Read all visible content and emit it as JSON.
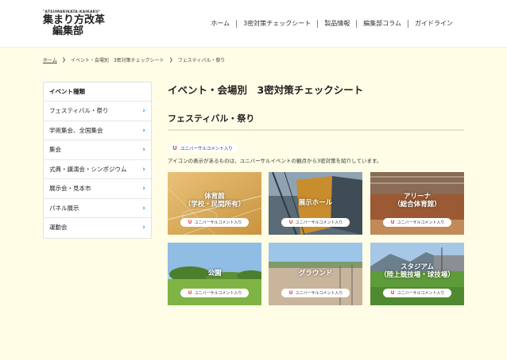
{
  "header": {
    "logo_sub": "\"ATSUMARIKATA-KAIKAKU\"",
    "logo_line1": "集まり方改革",
    "logo_line2": "編集部",
    "nav": [
      "ホーム",
      "3密対策チェックシート",
      "製品情報",
      "編集部コラム",
      "ガイドライン"
    ]
  },
  "breadcrumb": [
    "ホーム",
    "イベント・会場別　3密対策チェックシート",
    "フェスティバル・祭り"
  ],
  "sidebar": {
    "title": "イベント種類",
    "items": [
      {
        "label": "フェスティバル・祭り"
      },
      {
        "label": "学術集会、全国集会"
      },
      {
        "label": "集会"
      },
      {
        "label": "式典・講演会・シンポジウム"
      },
      {
        "label": "展示会・見本市"
      },
      {
        "label": "パネル展示"
      },
      {
        "label": "運動会"
      }
    ]
  },
  "main": {
    "title": "イベント・会場別　3密対策チェックシート",
    "section_title": "フェスティバル・祭り",
    "badge_label": "ユニバーサルコメント入り",
    "description": "アイコンの表示があるものは、ユニバーサルイベントの観点から3密対策を紹介しています。",
    "cards": [
      {
        "line1": "体育館",
        "line2": "（学校・民間所有）",
        "pill": "ユニバーサルコメント入り"
      },
      {
        "line1": "展示ホール",
        "line2": "",
        "pill": "ユニバーサルコメント入り"
      },
      {
        "line1": "アリーナ",
        "line2": "（総合体育館）",
        "pill": "ユニバーサルコメント入り"
      },
      {
        "line1": "公園",
        "line2": "",
        "pill": "ユニバーサルコメント入り"
      },
      {
        "line1": "グラウンド",
        "line2": "",
        "pill": "ユニバーサルコメント入り"
      },
      {
        "line1": "スタジアム",
        "line2": "（陸上競技場・球技場）",
        "pill": "ユニバーサルコメント入り"
      }
    ]
  },
  "colors": {
    "page_bg": "#fffde6",
    "accent_arrow": "#2a8fd8",
    "u_mark": "#e0453f"
  }
}
